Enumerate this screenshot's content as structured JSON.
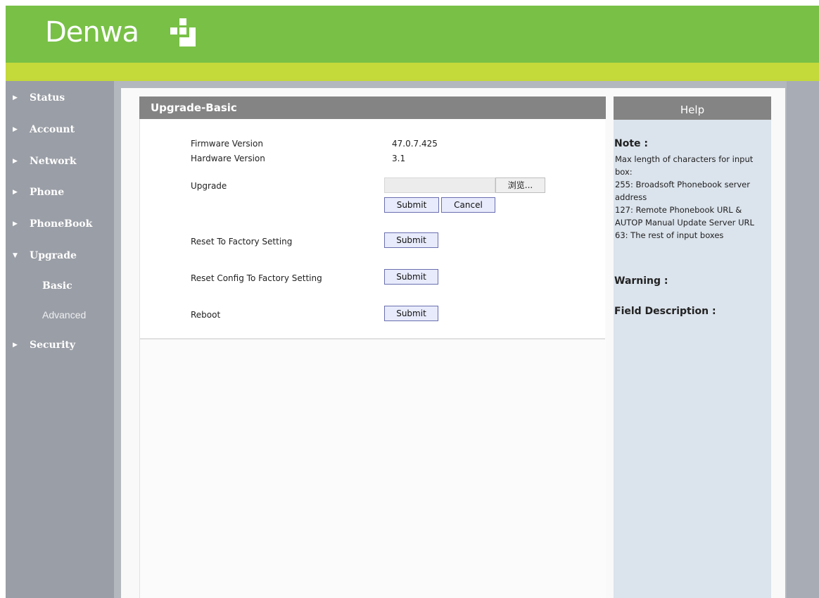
{
  "brand": {
    "name": "Denwa"
  },
  "colors": {
    "header_green": "#78c046",
    "stripe_lime": "#c4d93a",
    "sidebar_gray": "#9a9ea6",
    "panel_header_gray": "#848484",
    "help_bg": "#dbe3ec",
    "button_bg": "#e8ebfb",
    "button_border": "#6a6fb0"
  },
  "sidebar": {
    "items": [
      {
        "label": "Status",
        "icon": "triangle-right-icon",
        "expanded": false
      },
      {
        "label": "Account",
        "icon": "triangle-right-icon",
        "expanded": false
      },
      {
        "label": "Network",
        "icon": "triangle-right-icon",
        "expanded": false
      },
      {
        "label": "Phone",
        "icon": "triangle-right-icon",
        "expanded": false
      },
      {
        "label": "PhoneBook",
        "icon": "triangle-right-icon",
        "expanded": false
      },
      {
        "label": "Upgrade",
        "icon": "triangle-down-icon",
        "expanded": true
      },
      {
        "label": "Security",
        "icon": "triangle-right-icon",
        "expanded": false
      }
    ],
    "subitems": [
      {
        "label": "Basic",
        "selected": true
      },
      {
        "label": "Advanced",
        "selected": false
      }
    ]
  },
  "main": {
    "title": "Upgrade-Basic",
    "firmware_label": "Firmware Version",
    "firmware_value": "47.0.7.425",
    "hardware_label": "Hardware Version",
    "hardware_value": "3.1",
    "upgrade_label": "Upgrade",
    "browse_label": "浏览...",
    "submit_label": "Submit",
    "cancel_label": "Cancel",
    "reset_factory_label": "Reset To Factory Setting",
    "reset_config_label": "Reset Config To Factory Setting",
    "reboot_label": "Reboot"
  },
  "help": {
    "title": "Help",
    "note_heading": "Note :",
    "note_lines": [
      "Max length of characters for input",
      "box:",
      "255: Broadsoft Phonebook server",
      "address",
      "127: Remote Phonebook URL &",
      "AUTOP Manual Update Server URL",
      "63: The rest of input boxes"
    ],
    "warning_heading": "Warning :",
    "field_heading": "Field Description :"
  }
}
